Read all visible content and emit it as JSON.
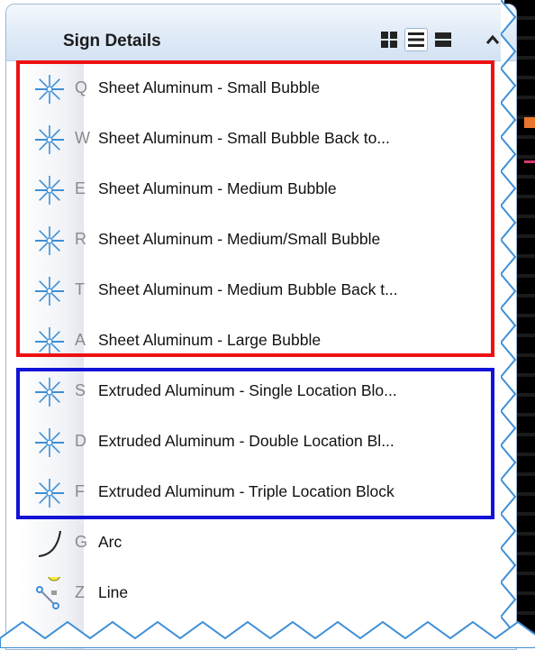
{
  "panel": {
    "title": "Sign Details",
    "view_buttons": [
      {
        "name": "grid-view-icon",
        "active": false
      },
      {
        "name": "list-view-icon",
        "active": true
      },
      {
        "name": "detail-view-icon",
        "active": false
      }
    ],
    "collapse_icon": "chevron-up-icon"
  },
  "items": [
    {
      "key": "Q",
      "label": "Sheet Aluminum - Small Bubble",
      "icon": "sign-point-icon",
      "group": "red"
    },
    {
      "key": "W",
      "label": "Sheet Aluminum - Small Bubble Back to...",
      "icon": "sign-point-icon",
      "group": "red"
    },
    {
      "key": "E",
      "label": "Sheet Aluminum - Medium Bubble",
      "icon": "sign-point-icon",
      "group": "red"
    },
    {
      "key": "R",
      "label": "Sheet Aluminum - Medium/Small Bubble",
      "icon": "sign-point-icon",
      "group": "red"
    },
    {
      "key": "T",
      "label": "Sheet Aluminum - Medium Bubble Back t...",
      "icon": "sign-point-icon",
      "group": "red"
    },
    {
      "key": "A",
      "label": "Sheet Aluminum - Large Bubble",
      "icon": "sign-point-icon",
      "group": "red"
    },
    {
      "key": "S",
      "label": "Extruded Aluminum - Single Location Blo...",
      "icon": "sign-point-icon",
      "group": "blue"
    },
    {
      "key": "D",
      "label": "Extruded Aluminum - Double Location Bl...",
      "icon": "sign-point-icon",
      "group": "blue"
    },
    {
      "key": "F",
      "label": "Extruded Aluminum - Triple Location Block",
      "icon": "sign-point-icon",
      "group": "blue"
    },
    {
      "key": "G",
      "label": "Arc",
      "icon": "arc-icon",
      "group": ""
    },
    {
      "key": "Z",
      "label": "Line",
      "icon": "line-icon",
      "group": ""
    }
  ],
  "colors": {
    "highlight_red": "#ee1111",
    "highlight_blue": "#1212d6",
    "header_bg": "#d3e2f3",
    "icon_blue": "#3d8fd6"
  }
}
